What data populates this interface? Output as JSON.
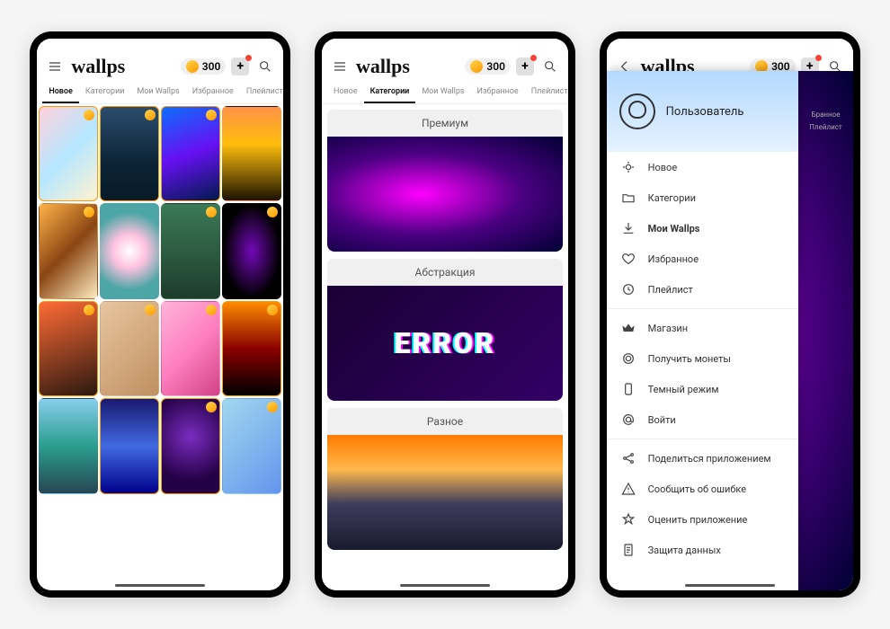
{
  "app": {
    "logo": "wallps",
    "coins": "300"
  },
  "tabs": [
    "Новое",
    "Категории",
    "Мои Wallps",
    "Избранное",
    "Плейлист"
  ],
  "screen1": {
    "activeTab": 0
  },
  "screen2": {
    "activeTab": 1,
    "categories": [
      "Премиум",
      "Абстракция",
      "Разное"
    ],
    "errorText": "ERROR"
  },
  "screen3": {
    "user": "Пользователь",
    "nav": [
      "Новое",
      "Категории",
      "Мои Wallps",
      "Избранное",
      "Плейлист"
    ],
    "actions": [
      "Магазин",
      "Получить монеты",
      "Темный режим",
      "Войти"
    ],
    "footer": [
      "Поделиться приложением",
      "Сообщить об ошибке",
      "Оценить приложение",
      "Защита данных"
    ],
    "bgTabs": [
      "Бранное",
      "Плейлист"
    ]
  }
}
